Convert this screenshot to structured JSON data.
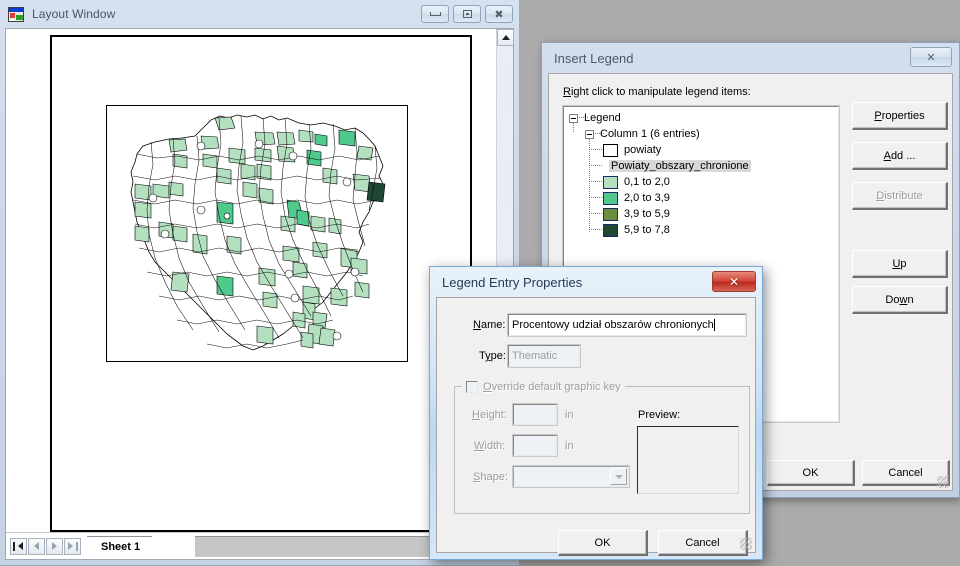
{
  "desktop": {
    "background": "#ababab"
  },
  "layout_window": {
    "title": "Layout Window",
    "icon": "application-icon",
    "buttons": {
      "minimize": "minimize-icon",
      "restore": "restore-icon",
      "close": "close-icon"
    },
    "tab_bar": {
      "nav_first": "first-record-icon",
      "nav_prev": "previous-record-icon",
      "nav_next": "next-record-icon",
      "nav_last": "last-record-icon",
      "active_tab": "Sheet 1",
      "scroll_left": "scroll-left-icon"
    },
    "scrollbar": {
      "up": "scroll-up-icon"
    }
  },
  "insert_legend": {
    "title": "Insert Legend",
    "close_label": "✕",
    "hint": "Right click to manipulate legend items:",
    "hint_accel": "R",
    "tree": [
      {
        "label": "Legend",
        "level": 0,
        "expander": true,
        "swatch": null
      },
      {
        "label": "Column 1 (6 entries)",
        "level": 1,
        "expander": true,
        "swatch": null
      },
      {
        "label": "powiaty",
        "level": 2,
        "expander": false,
        "swatch": "#ffffff",
        "hollow": true
      },
      {
        "label": "Powiaty_obszary_chronione",
        "level": 2,
        "expander": false,
        "swatch": null,
        "selected": true
      },
      {
        "label": "0,1 to 2,0",
        "level": 2,
        "expander": false,
        "swatch": "#b3e0bf"
      },
      {
        "label": "2,0 to 3,9",
        "level": 2,
        "expander": false,
        "swatch": "#4fc98c"
      },
      {
        "label": "3,9 to 5,9",
        "level": 2,
        "expander": false,
        "swatch": "#6b8f3c"
      },
      {
        "label": "5,9 to 7,8",
        "level": 2,
        "expander": false,
        "swatch": "#1f4734"
      }
    ],
    "buttons": {
      "properties": "Properties",
      "add": "Add ...",
      "distribute": "Distribute",
      "up": "Up",
      "down": "Down",
      "ok": "OK",
      "cancel": "Cancel"
    }
  },
  "legend_entry_properties": {
    "title": "Legend Entry Properties",
    "close_label": "✕",
    "name_label": "Name:",
    "name_value": "Procentowy udział obszarów chronionych",
    "type_label": "Type:",
    "type_value": "Thematic",
    "override_label": "Override default graphic key",
    "height_label": "Height:",
    "height_value": "",
    "height_unit": "in",
    "width_label": "Width:",
    "width_value": "",
    "width_unit": "in",
    "shape_label": "Shape:",
    "shape_value": "",
    "preview_label": "Preview:",
    "ok": "OK",
    "cancel": "Cancel"
  },
  "map": {
    "title": "Poland powiaty choropleth",
    "outline_color": "#000000",
    "classes": [
      {
        "range": "0,1 to 2,0",
        "color": "#b3e0bf"
      },
      {
        "range": "2,0 to 3,9",
        "color": "#4fc98c"
      },
      {
        "range": "3,9 to 5,9",
        "color": "#6b8f3c"
      },
      {
        "range": "5,9 to 7,8",
        "color": "#1f4734"
      }
    ]
  }
}
